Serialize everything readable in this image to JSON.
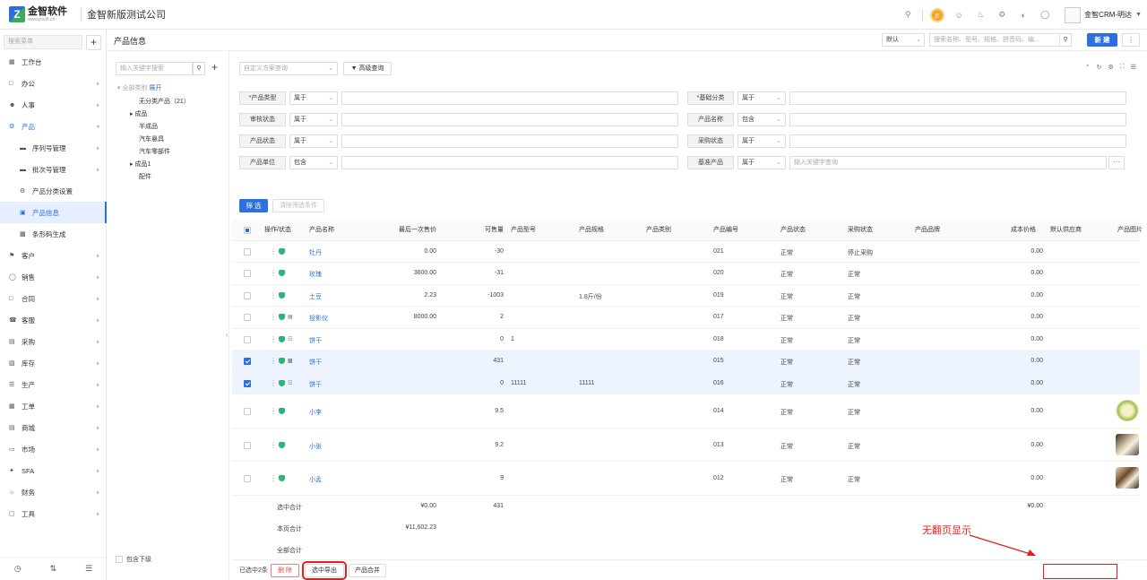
{
  "topbar": {
    "logo_name": "金智软件",
    "logo_url": "www.jzsoft.cn",
    "company": "金智新版测试公司",
    "user_name": "金智CRM-明达"
  },
  "sidebar": {
    "search_placeholder": "搜索菜单",
    "items": [
      {
        "label": "工作台",
        "icon": "grid-icon"
      },
      {
        "label": "办公",
        "icon": "office-icon"
      },
      {
        "label": "人事",
        "icon": "person-icon"
      },
      {
        "label": "产品",
        "icon": "product-icon"
      },
      {
        "label": "序列号管理",
        "icon": "folder-icon"
      },
      {
        "label": "批次号管理",
        "icon": "folder-icon"
      },
      {
        "label": "产品分类设置",
        "icon": "gear-icon"
      },
      {
        "label": "产品信息",
        "icon": "doc-icon"
      },
      {
        "label": "条形码生成",
        "icon": "barcode-icon"
      },
      {
        "label": "客户",
        "icon": "customer-icon"
      },
      {
        "label": "销售",
        "icon": "sales-icon"
      },
      {
        "label": "合同",
        "icon": "contract-icon"
      },
      {
        "label": "客服",
        "icon": "service-icon"
      },
      {
        "label": "采购",
        "icon": "purchase-icon"
      },
      {
        "label": "库存",
        "icon": "stock-icon"
      },
      {
        "label": "生产",
        "icon": "production-icon"
      },
      {
        "label": "工单",
        "icon": "ticket-icon"
      },
      {
        "label": "商城",
        "icon": "mall-icon"
      },
      {
        "label": "市场",
        "icon": "market-icon"
      },
      {
        "label": "SFA",
        "icon": "sfa-icon"
      },
      {
        "label": "财务",
        "icon": "finance-icon"
      },
      {
        "label": "工具",
        "icon": "tool-icon"
      }
    ]
  },
  "header": {
    "page_title": "产品信息",
    "view_select": "默认",
    "search_placeholder": "搜索名称、型号、规格、拼音码、编...",
    "new_button": "新 建"
  },
  "tree": {
    "search_placeholder": "输入关键字搜索",
    "root": "全部类别",
    "expand": "展开",
    "nodes": [
      "无分类产品（21）",
      "成品",
      "半成品",
      "汽车悬具",
      "汽车零部件",
      "成品1",
      "配件"
    ],
    "include_sub": "包含下级"
  },
  "query": {
    "custom_placeholder": "自定义方案查询",
    "advanced": "高级查询",
    "filters": [
      {
        "label": "*产品类型",
        "op": "属于",
        "placeholder": ""
      },
      {
        "label": "*基础分类",
        "op": "属于",
        "placeholder": ""
      },
      {
        "label": "审核状态",
        "op": "属于",
        "placeholder": ""
      },
      {
        "label": "产品名称",
        "op": "包含",
        "placeholder": ""
      },
      {
        "label": "产品状态",
        "op": "属于",
        "placeholder": ""
      },
      {
        "label": "采购状态",
        "op": "属于",
        "placeholder": ""
      },
      {
        "label": "产品单位",
        "op": "包含",
        "placeholder": ""
      },
      {
        "label": "基准产品",
        "op": "属于",
        "placeholder": "输入关键字查询"
      }
    ],
    "filter_button": "筛 选",
    "clear_button": "清除筛选条件"
  },
  "table": {
    "headers": [
      "操作/状态",
      "产品名称",
      "最后一次售价",
      "可售量",
      "产品型号",
      "产品规格",
      "产品类别",
      "产品编号",
      "产品状态",
      "采购状态",
      "产品品牌",
      "成本价格",
      "默认供应商",
      "产品图片"
    ],
    "rows": [
      {
        "name": "牡丹",
        "price": "0.00",
        "qty": "-30",
        "model": "",
        "spec": "",
        "code": "021",
        "status": "正常",
        "purchase": "停止采购",
        "cost": "0.00",
        "selected": false
      },
      {
        "name": "玫瑰",
        "price": "3600.00",
        "qty": "-31",
        "model": "",
        "spec": "",
        "code": "020",
        "status": "正常",
        "purchase": "正常",
        "cost": "0.00",
        "selected": false
      },
      {
        "name": "土豆",
        "price": "2.23",
        "qty": "-1003",
        "model": "",
        "spec": "1.8斤/份",
        "code": "019",
        "status": "正常",
        "purchase": "正常",
        "cost": "0.00",
        "selected": false
      },
      {
        "name": "投影仪",
        "price": "8000.00",
        "qty": "2",
        "model": "",
        "spec": "",
        "code": "017",
        "status": "正常",
        "purchase": "正常",
        "cost": "0.00",
        "selected": false
      },
      {
        "name": "饼干",
        "price": "",
        "qty": "0",
        "model": "1",
        "spec": "",
        "code": "018",
        "status": "正常",
        "purchase": "正常",
        "cost": "0.00",
        "selected": false
      },
      {
        "name": "饼干",
        "price": "",
        "qty": "431",
        "model": "",
        "spec": "",
        "code": "015",
        "status": "正常",
        "purchase": "正常",
        "cost": "0.00",
        "selected": true
      },
      {
        "name": "饼干",
        "price": "",
        "qty": "0",
        "model": "11111",
        "spec": "11111",
        "code": "016",
        "status": "正常",
        "purchase": "正常",
        "cost": "0.00",
        "selected": true
      },
      {
        "name": "小李",
        "price": "",
        "qty": "9.5",
        "model": "",
        "spec": "",
        "code": "014",
        "status": "正常",
        "purchase": "正常",
        "cost": "0.00",
        "selected": false
      },
      {
        "name": "小张",
        "price": "",
        "qty": "9.2",
        "model": "",
        "spec": "",
        "code": "013",
        "status": "正常",
        "purchase": "正常",
        "cost": "0.00",
        "selected": false
      },
      {
        "name": "小孟",
        "price": "",
        "qty": "9",
        "model": "",
        "spec": "",
        "code": "012",
        "status": "正常",
        "purchase": "正常",
        "cost": "0.00",
        "selected": false
      }
    ],
    "summary": [
      {
        "label": "选中合计",
        "price": "¥0.00",
        "qty": "431",
        "cost": "¥0.00"
      },
      {
        "label": "本页合计",
        "price": "¥11,602.23",
        "qty": "",
        "cost": ""
      },
      {
        "label": "全部合计",
        "price": "",
        "qty": "",
        "cost": ""
      }
    ]
  },
  "footer": {
    "selected_count": "已选中2条",
    "delete": "删 除",
    "export_selected": "选中导出",
    "merge": "产品合并"
  },
  "annotation": {
    "text": "无翻页显示",
    "color": "#e02020"
  }
}
